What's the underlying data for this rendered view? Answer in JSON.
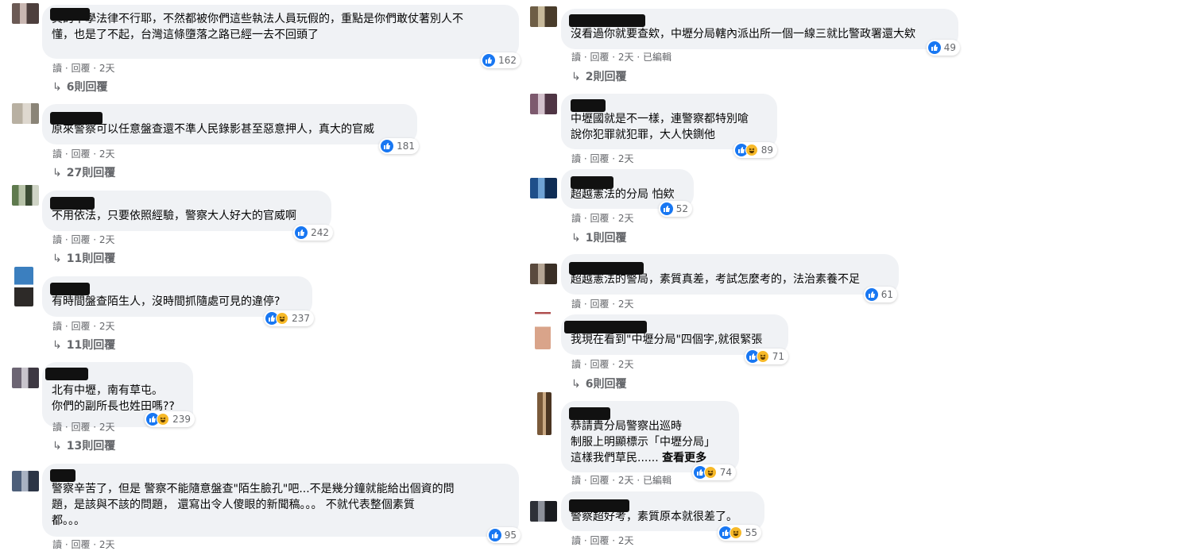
{
  "meta_sep": "讀 · 回覆 · ",
  "left": [
    {
      "text": "真的不學法律不行耶，不然都被你們這些執法人員玩假的，重點是你們敢仗著別人不\n懂，也是了不起，台灣這條墮落之路已經一去不回頭了",
      "time": "2天",
      "reactions": "162",
      "haha": false,
      "replies": "6則回覆"
    },
    {
      "text": "原來警察可以任意盤查還不準人民錄影甚至惡意押人，真大的官威",
      "time": "2天",
      "reactions": "181",
      "haha": false,
      "replies": "27則回覆"
    },
    {
      "text": "不用依法，只要依照經驗，警察大人好大的官威啊",
      "time": "2天",
      "reactions": "242",
      "haha": false,
      "replies": "11則回覆"
    },
    {
      "text": "有時間盤查陌生人，沒時間抓隨處可見的違停?",
      "time": "2天",
      "reactions": "237",
      "haha": true,
      "replies": "11則回覆"
    },
    {
      "text": "北有中壢，南有草屯。\n你們的副所長也姓田嗎??",
      "time": "2天",
      "reactions": "239",
      "haha": true,
      "replies": "13則回覆"
    },
    {
      "text": "警察辛苦了，但是 警察不能隨意盤查\"陌生臉孔\"吧...不是幾分鐘就能給出個資的問\n題，是該與不該的問題， 還寫出令人傻眼的新聞稿。。。 不就代表整個素質\n都。。。",
      "time": "2天",
      "reactions": "95",
      "haha": false,
      "replies": ""
    }
  ],
  "right": [
    {
      "text": "沒看過你就要查欸，中壢分局轄內派出所一個一線三就比警政署還大欸",
      "time": "2天 · 已編輯",
      "reactions": "49",
      "haha": false,
      "replies": "2則回覆"
    },
    {
      "text": "中壢國就是不一樣，連警察都特別嗆\n說你犯罪就犯罪，大人快鍘他",
      "time": "2天",
      "reactions": "89",
      "haha": true,
      "replies": ""
    },
    {
      "text": "超越憲法的分局 怕欸",
      "time": "2天",
      "reactions": "52",
      "haha": false,
      "replies": "1則回覆"
    },
    {
      "text": "超越憲法的警局，素質真差，考試怎麼考的，法治素養不足",
      "time": "2天",
      "reactions": "61",
      "haha": false,
      "replies": ""
    },
    {
      "text": "我現在看到\"中壢分局\"四個字,就很緊張",
      "time": "2天",
      "reactions": "71",
      "haha": true,
      "replies": "6則回覆"
    },
    {
      "text": "恭請貴分局警察出巡時\n制服上明顯標示「中壢分局」\n這樣我們草民...... ",
      "more": "查看更多",
      "time": "2天 · 已編輯",
      "reactions": "74",
      "haha": true,
      "replies": ""
    },
    {
      "text": "警察超好考，素質原本就很差了。",
      "time": "2天",
      "reactions": "55",
      "haha": true,
      "replies": ""
    }
  ],
  "colors": {
    "bubble": "#f0f2f5",
    "like": "#1877f2",
    "haha": "#f7b928",
    "meta": "#65676b"
  }
}
